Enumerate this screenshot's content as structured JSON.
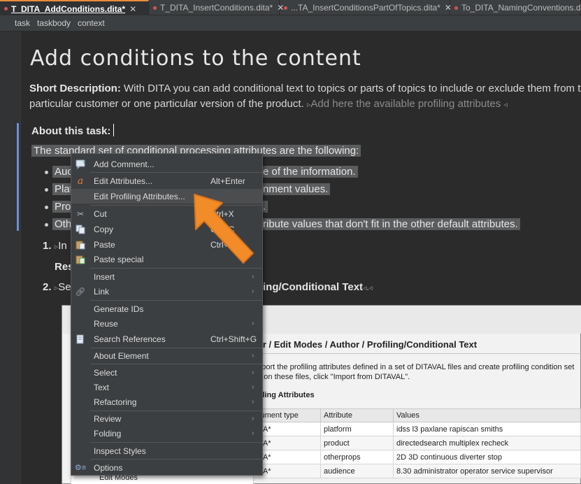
{
  "tabs": [
    {
      "label": "T_DITA_AddConditions.dita*",
      "modified": true,
      "active": true
    },
    {
      "label": "T_DITA_InsertConditions.dita*",
      "modified": true,
      "active": false
    },
    {
      "label": "...TA_InsertConditionsPartOfTopics.dita*",
      "modified": true,
      "active": false
    },
    {
      "label": "To_DITA_NamingConventions.dita",
      "modified": true,
      "active": false
    }
  ],
  "breadcrumb": [
    "task",
    "taskbody",
    "context"
  ],
  "doc": {
    "title": "Add conditions to the content",
    "short_label": "Short Description:",
    "short_text_1": " With DITA you can add conditional text to topics or parts of topics to include or exclude them from the out",
    "short_text_2": "particular customer or one particular version of the product. ",
    "placeholder": "Add here the available profiling attributes",
    "about": "About this task:",
    "std_line": "The standard set of conditional processing attributes are the following:",
    "bullets": [
      {
        "left": "Aud",
        "right": "e of the information."
      },
      {
        "left": "Plat",
        "right": "nment values."
      },
      {
        "left": "Pro",
        "right": "."
      },
      {
        "left": "Othe",
        "right": "ribute values that don't fit in the other default attributes."
      }
    ],
    "step1_num": "1.",
    "step1_text": "In",
    "result_label": "Res",
    "step2_num": "2.",
    "step2_text": "Se",
    "step2_bold": "ing/Conditional Text"
  },
  "embedded": {
    "heading": "itor / Edit Modes / Author / Profiling/Conditional Text",
    "line1": "Import the profiling attributes defined in a set of DITAVAL files and create profiling condition set",
    "line2": "ed on these files, click \"Import from DITAVAL\".",
    "subhead": "ofiling Attributes",
    "columns": [
      "cument type",
      "Attribute",
      "Values"
    ],
    "rows": [
      [
        "ITA*",
        "platform",
        "idss l3 paxlane rapiscan smiths"
      ],
      [
        "ITA*",
        "product",
        "directedsearch multiplex recheck"
      ],
      [
        "ITA*",
        "otherprops",
        "2D 3D continuous diverter stop"
      ],
      [
        "ITA*",
        "audience",
        "8.30 administrator operator service supervisor"
      ]
    ],
    "tree_item": "Edit Modes"
  },
  "menu": {
    "items": [
      {
        "label": "Add Comment...",
        "shortcut": "",
        "submenu": false,
        "icon": "comment-icon"
      },
      {
        "label": "Edit Attributes...",
        "shortcut": "Alt+Enter",
        "submenu": false,
        "icon": "attribute-icon"
      },
      {
        "label": "Edit Profiling Attributes...",
        "shortcut": "",
        "submenu": false,
        "icon": ""
      },
      {
        "label": "Cut",
        "shortcut": "Ctrl+X",
        "submenu": false,
        "icon": "scissors-icon"
      },
      {
        "label": "Copy",
        "shortcut": "Ctrl+C",
        "submenu": false,
        "icon": "copy-icon"
      },
      {
        "label": "Paste",
        "shortcut": "Ctrl+V",
        "submenu": false,
        "icon": "paste-icon"
      },
      {
        "label": "Paste special",
        "shortcut": "",
        "submenu": false,
        "icon": "paste-special-icon"
      },
      {
        "label": "Insert",
        "shortcut": "",
        "submenu": true,
        "icon": ""
      },
      {
        "label": "Link",
        "shortcut": "",
        "submenu": true,
        "icon": "link-icon"
      },
      {
        "label": "Generate IDs",
        "shortcut": "",
        "submenu": false,
        "icon": ""
      },
      {
        "label": "Reuse",
        "shortcut": "",
        "submenu": true,
        "icon": ""
      },
      {
        "label": "Search References",
        "shortcut": "Ctrl+Shift+G",
        "submenu": false,
        "icon": "search-references-icon"
      },
      {
        "label": "About Element",
        "shortcut": "",
        "submenu": true,
        "icon": ""
      },
      {
        "label": "Select",
        "shortcut": "",
        "submenu": true,
        "icon": ""
      },
      {
        "label": "Text",
        "shortcut": "",
        "submenu": true,
        "icon": ""
      },
      {
        "label": "Refactoring",
        "shortcut": "",
        "submenu": true,
        "icon": ""
      },
      {
        "label": "Review",
        "shortcut": "",
        "submenu": true,
        "icon": ""
      },
      {
        "label": "Folding",
        "shortcut": "",
        "submenu": true,
        "icon": ""
      },
      {
        "label": "Inspect Styles",
        "shortcut": "",
        "submenu": false,
        "icon": ""
      },
      {
        "label": "Options",
        "shortcut": "",
        "submenu": false,
        "icon": "options-icon"
      }
    ]
  },
  "colors": {
    "accent_tab": "#e98b3a",
    "arrow": "#f28c28",
    "change_bar": "#6b8fd6"
  }
}
